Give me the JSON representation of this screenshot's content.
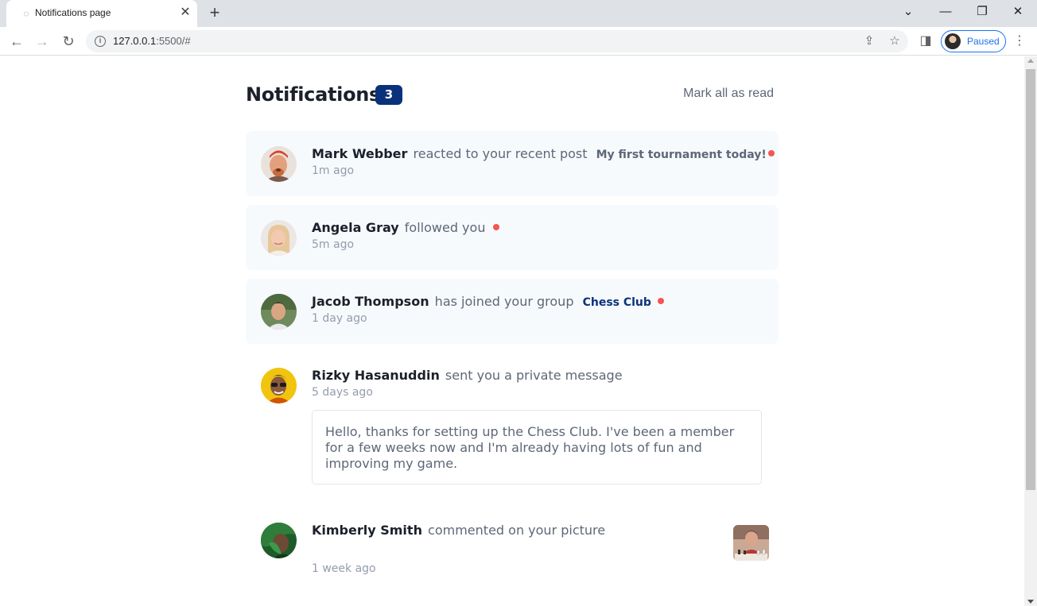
{
  "browser": {
    "tab_title": "Notifications page",
    "tab_close": "✕",
    "new_tab": "+",
    "url_host": "127.0.0.1",
    "url_rest": ":5500/#",
    "profile_label": "Paused",
    "icons": [
      "favicon",
      "close-icon",
      "plus-icon",
      "chevron-down-icon",
      "minimize-icon",
      "restore-icon",
      "window-close-icon",
      "back-icon",
      "forward-icon",
      "reload-icon",
      "info-icon",
      "share-icon",
      "star-icon",
      "sidepanel-icon",
      "kebab-menu-icon"
    ]
  },
  "header": {
    "title": "Notifications",
    "unread_count": "3",
    "mark_all": "Mark all as read"
  },
  "notifications": [
    {
      "name": "Mark Webber",
      "action": "reacted to your recent post",
      "target": "My first tournament today!",
      "time": "1m ago",
      "unread": true
    },
    {
      "name": "Angela Gray",
      "action": "followed you",
      "target": "",
      "time": "5m ago",
      "unread": true
    },
    {
      "name": "Jacob Thompson",
      "action": "has joined your group",
      "target": "Chess Club",
      "time": "1 day ago",
      "unread": true
    },
    {
      "name": "Rizky Hasanuddin",
      "action": "sent you a private message",
      "target": "",
      "time": "5 days ago",
      "unread": false,
      "message": "Hello, thanks for setting up the Chess Club. I've been a member for a few weeks now and I'm already having lots of fun and improving my game."
    },
    {
      "name": "Kimberly Smith",
      "action": "commented on your picture",
      "target": "",
      "time": "1 week ago",
      "unread": false
    }
  ],
  "colors": {
    "unread_bg": "#f7fafd",
    "badge": "#0a327b",
    "dot": "#f65552",
    "heading": "#1c202b",
    "body_text": "#5e6778",
    "time": "#939cad"
  }
}
